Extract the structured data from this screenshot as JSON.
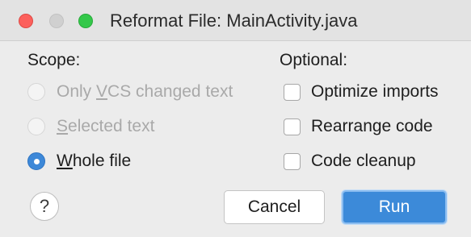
{
  "window": {
    "title": "Reformat File: MainActivity.java"
  },
  "scope": {
    "label": "Scope:",
    "options": [
      {
        "mnemonic": "",
        "pre": "Only ",
        "mid": "V",
        "post": "CS changed text",
        "enabled": false,
        "selected": false
      },
      {
        "pre": "",
        "mid": "S",
        "post": "elected text",
        "enabled": false,
        "selected": false
      },
      {
        "pre": "",
        "mid": "W",
        "post": "hole file",
        "enabled": true,
        "selected": true
      }
    ]
  },
  "optional": {
    "label": "Optional:",
    "options": [
      {
        "label": "Optimize imports",
        "checked": false
      },
      {
        "label": "Rearrange code",
        "checked": false
      },
      {
        "label": "Code cleanup",
        "checked": false
      }
    ]
  },
  "buttons": {
    "help": "?",
    "cancel": "Cancel",
    "run": "Run"
  },
  "colors": {
    "accent": "#3c8ad9",
    "close": "#fc605c",
    "maximize": "#34c84a",
    "disabled_text": "#a9a9a9"
  }
}
